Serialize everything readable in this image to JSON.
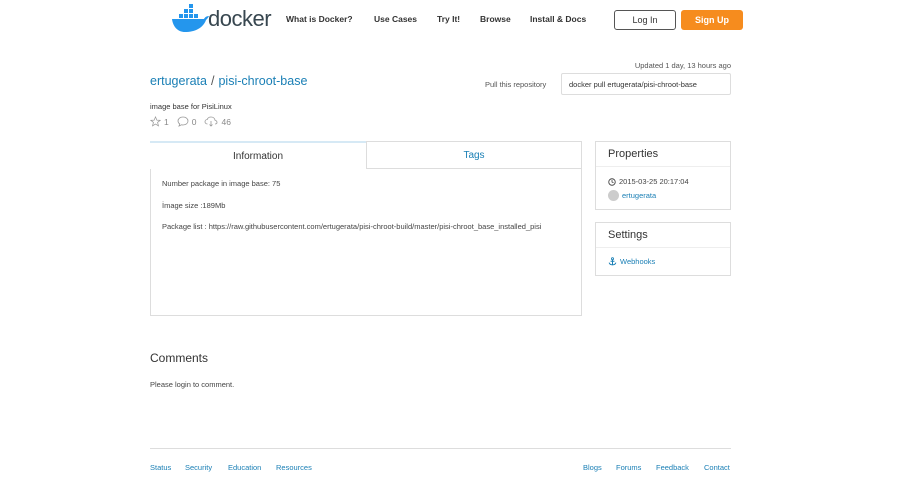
{
  "header": {
    "logo_text": "docker",
    "nav": [
      "What is Docker?",
      "Use Cases",
      "Try It!",
      "Browse",
      "Install & Docs"
    ],
    "login_label": "Log In",
    "signup_label": "Sign Up",
    "signup_color": "#f68c1e"
  },
  "repo": {
    "updated": "Updated 1 day, 13 hours ago",
    "owner": "ertugerata",
    "separator": "/",
    "name": "pisi-chroot-base",
    "pull_label": "Pull this repository",
    "pull_command": "docker pull ertugerata/pisi-chroot-base",
    "description": "image base for PisiLinux",
    "stars": "1",
    "comments": "0",
    "downloads": "46"
  },
  "tabs": {
    "information": "Information",
    "tags": "Tags"
  },
  "information": {
    "line1": "Number package in image base: 75",
    "line2": "İmage size :189Mb",
    "line3": "Package list : https://raw.githubusercontent.com/ertugerata/pisi-chroot-build/master/pisi-chroot_base_installed_pisi"
  },
  "properties": {
    "title": "Properties",
    "date": "2015-03-25 20:17:04",
    "user": "ertugerata"
  },
  "settings": {
    "title": "Settings",
    "webhooks": "Webhooks"
  },
  "comments": {
    "title": "Comments",
    "message": "Please login to comment."
  },
  "footer": {
    "left": [
      "Status",
      "Security",
      "Education",
      "Resources"
    ],
    "right": [
      "Blogs",
      "Forums",
      "Feedback",
      "Contact"
    ]
  },
  "colors": {
    "link": "#1a7fb5",
    "logo_whale": "#2496ed"
  }
}
